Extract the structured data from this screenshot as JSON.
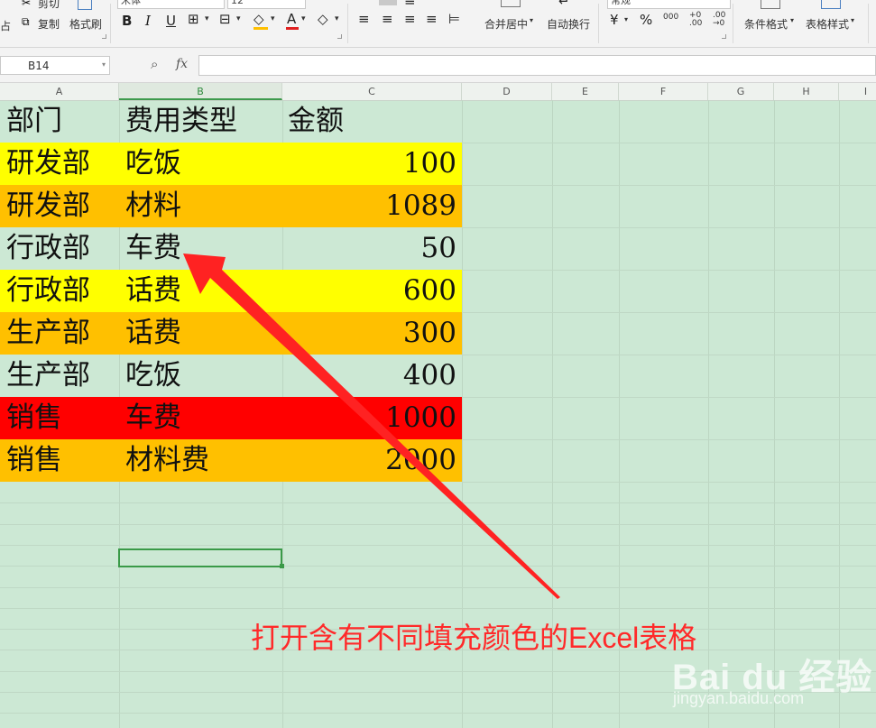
{
  "ribbon": {
    "cut_label": "剪切",
    "copy_label": "复制",
    "format_painter_label": "格式刷",
    "font_name": "宋体",
    "font_size": "12",
    "bold": "B",
    "italic": "I",
    "underline": "U",
    "merge_center_label": "合并居中",
    "wrap_text_label": "自动换行",
    "number_format": "常规",
    "percent": "%",
    "thousands": "000",
    "conditional_format_label": "条件格式",
    "table_style_label": "表格样式"
  },
  "formula_bar": {
    "name_box": "B14",
    "fx_label": "fx",
    "formula": ""
  },
  "columns": [
    "A",
    "B",
    "C",
    "D",
    "E",
    "F",
    "G",
    "H",
    "I"
  ],
  "selected_column": "B",
  "sheet": {
    "rows": [
      {
        "dept": "部门",
        "type": "费用类型",
        "amount": "金额",
        "fill": "none"
      },
      {
        "dept": "研发部",
        "type": "吃饭",
        "amount": "100",
        "fill": "#ffff00"
      },
      {
        "dept": "研发部",
        "type": "材料",
        "amount": "1089",
        "fill": "#ffc000"
      },
      {
        "dept": "行政部",
        "type": "车费",
        "amount": "50",
        "fill": "none"
      },
      {
        "dept": "行政部",
        "type": "话费",
        "amount": "600",
        "fill": "#ffff00"
      },
      {
        "dept": "生产部",
        "type": "话费",
        "amount": "300",
        "fill": "#ffc000"
      },
      {
        "dept": "生产部",
        "type": "吃饭",
        "amount": "400",
        "fill": "none"
      },
      {
        "dept": "销售",
        "type": "车费",
        "amount": "1000",
        "fill": "#ff0000"
      },
      {
        "dept": "销售",
        "type": "材料费",
        "amount": "2000",
        "fill": "#ffc000"
      }
    ]
  },
  "annotation": {
    "text": "打开含有不同填充颜色的Excel表格",
    "color": "#ff2a2a"
  },
  "watermark": {
    "logo": "Bai du 经验",
    "url": "jingyan.baidu.com"
  },
  "colors": {
    "grid_bg": "#cce8d4",
    "yellow": "#ffff00",
    "orange": "#ffc000",
    "red": "#ff0000",
    "selection": "#3a9a48"
  }
}
